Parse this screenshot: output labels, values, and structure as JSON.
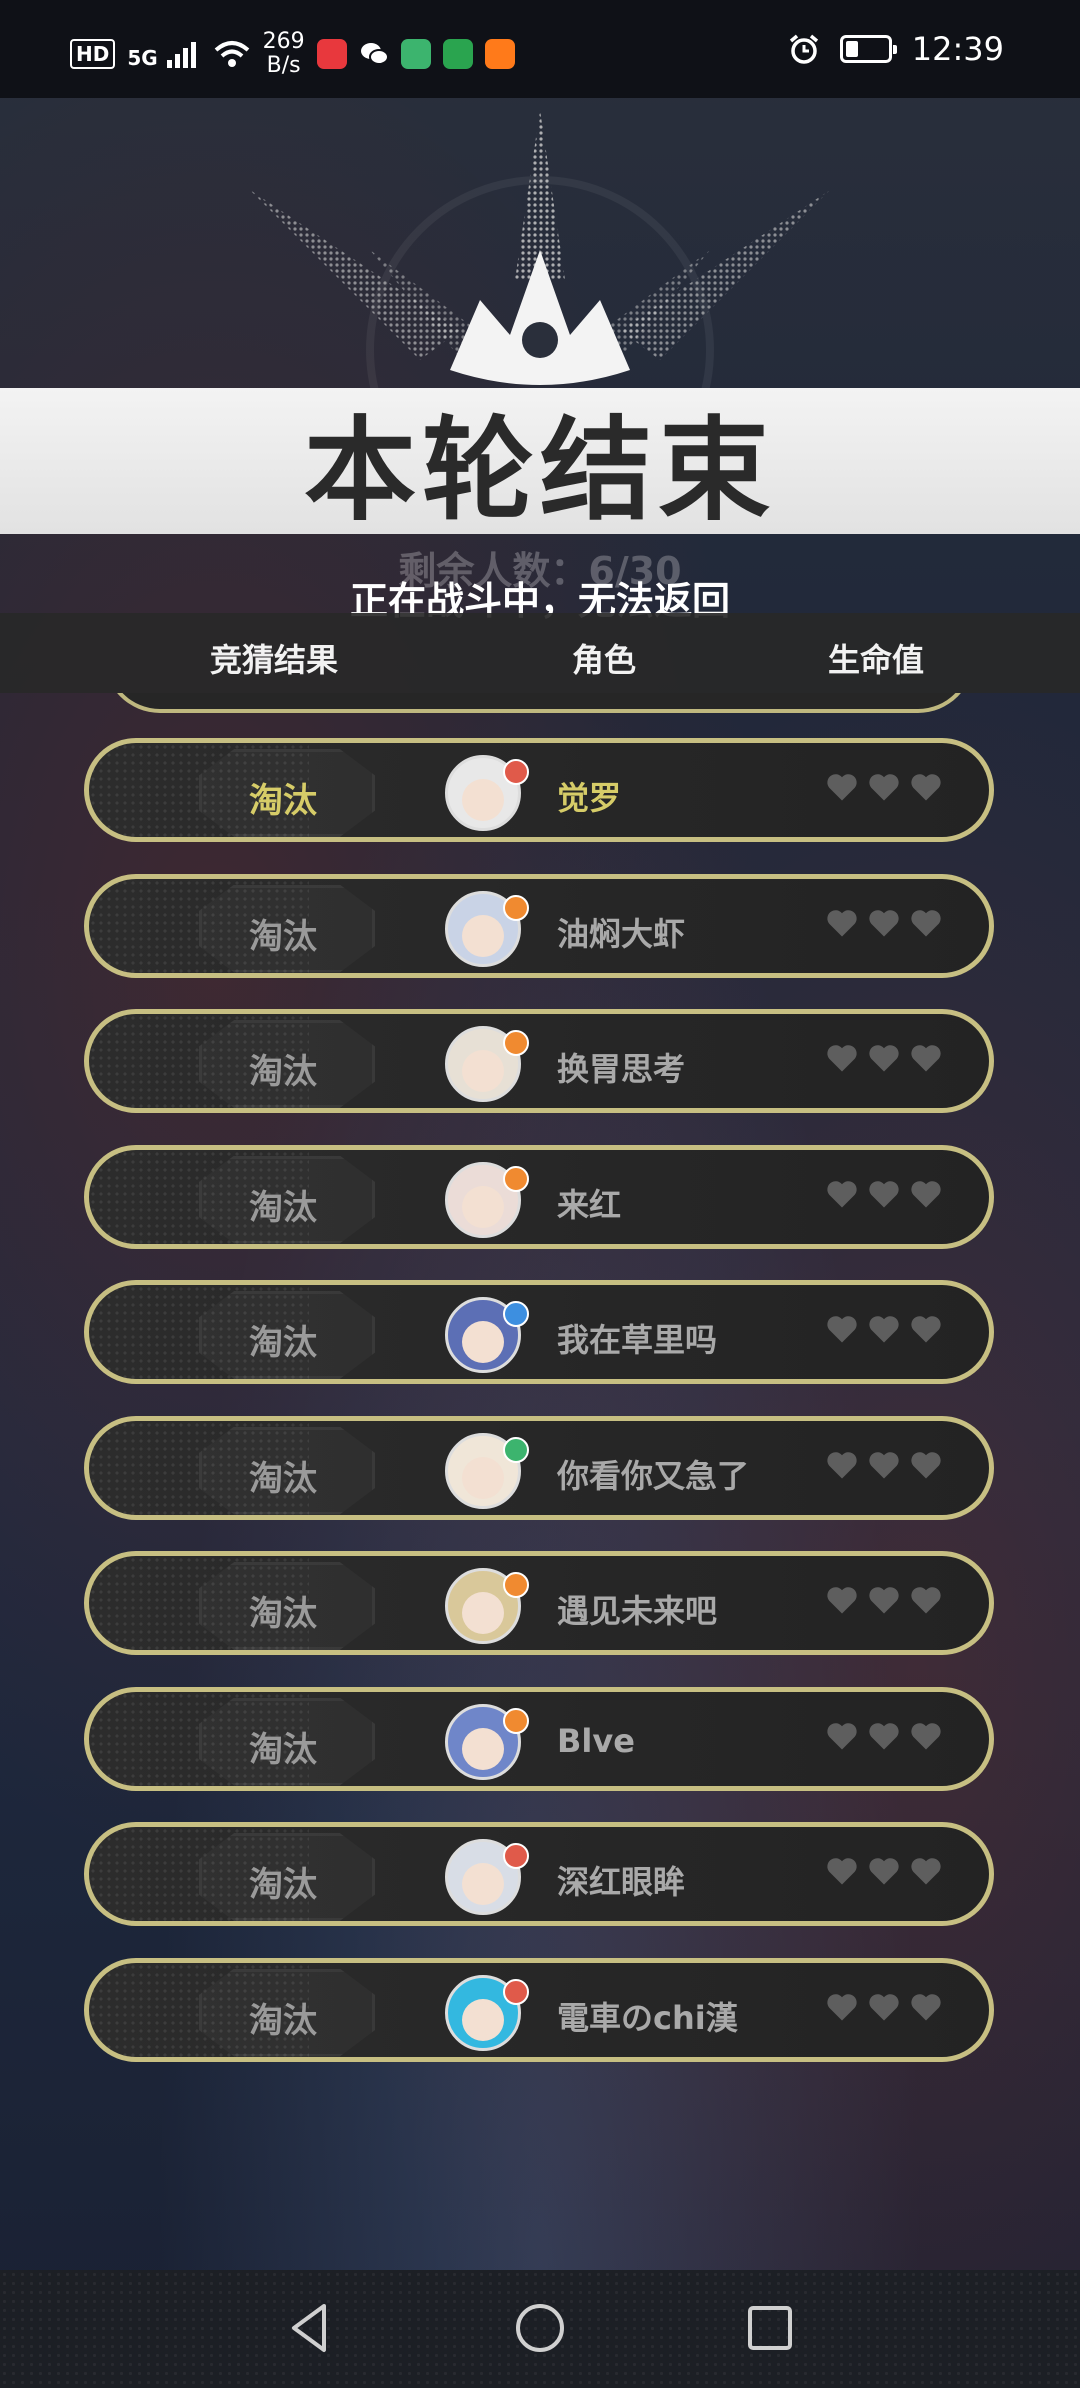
{
  "status_bar": {
    "hd": "HD",
    "network": "5G",
    "speed_value": "269",
    "speed_unit": "B/s",
    "app_colors": [
      "#e8383d",
      "#ffffff",
      "#3cb46e",
      "#2aa44f",
      "#ff7a1a"
    ],
    "battery_level": 0.3,
    "time": "12:39"
  },
  "header": {
    "title": "本轮结束",
    "remaining": "剩余人数：6/30",
    "toast": "正在战斗中，无法返回"
  },
  "columns": {
    "result": "竞猜结果",
    "role": "角色",
    "hp": "生命值"
  },
  "players": [
    {
      "result": "淘汰",
      "name": "觉罗",
      "avatar_color": "#e8e8e8",
      "badge_color": "#e05a4a",
      "hearts": 3
    },
    {
      "result": "淘汰",
      "name": "油焖大虾",
      "avatar_color": "#c9d3e6",
      "badge_color": "#f08a30",
      "hearts": 3
    },
    {
      "result": "淘汰",
      "name": "换胃思考",
      "avatar_color": "#e7e0d5",
      "badge_color": "#f08a30",
      "hearts": 3
    },
    {
      "result": "淘汰",
      "name": "来红",
      "avatar_color": "#ebdcd7",
      "badge_color": "#f08a30",
      "hearts": 3
    },
    {
      "result": "淘汰",
      "name": "我在草里吗",
      "avatar_color": "#5c6fb5",
      "badge_color": "#3d8fe0",
      "hearts": 3
    },
    {
      "result": "淘汰",
      "name": "你看你又急了",
      "avatar_color": "#f0e6d8",
      "badge_color": "#3cb46e",
      "hearts": 3
    },
    {
      "result": "淘汰",
      "name": "遇见未来吧",
      "avatar_color": "#d9c89a",
      "badge_color": "#f08a30",
      "hearts": 3
    },
    {
      "result": "淘汰",
      "name": "Blve",
      "avatar_color": "#6f86c9",
      "badge_color": "#f08a30",
      "hearts": 3
    },
    {
      "result": "淘汰",
      "name": "深红眼眸",
      "avatar_color": "#d8dde6",
      "badge_color": "#e05a4a",
      "hearts": 3
    },
    {
      "result": "淘汰",
      "name": "電車のchi漢",
      "avatar_color": "#33b8e0",
      "badge_color": "#e05a4a",
      "hearts": 3
    }
  ]
}
